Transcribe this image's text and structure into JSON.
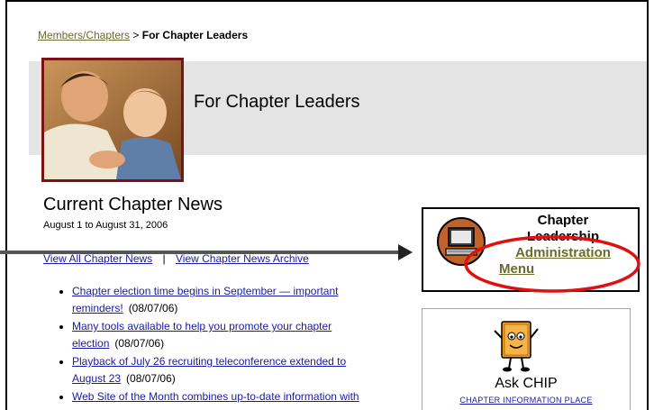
{
  "breadcrumb": {
    "parent": "Members/Chapters",
    "separator": ">",
    "current": "For Chapter Leaders"
  },
  "header": {
    "title": "For Chapter Leaders",
    "image": "father-and-son-photo"
  },
  "news": {
    "heading": "Current Chapter News",
    "date_range": "August 1 to August 31, 2006",
    "link_all": "View All Chapter News",
    "link_separator": "|",
    "link_archive": "View Chapter News Archive",
    "items": [
      {
        "lines": [
          "Chapter election time begins in September — important",
          "reminders!"
        ],
        "date": "(08/07/06)"
      },
      {
        "lines": [
          "Many tools available to help you promote your chapter",
          "election"
        ],
        "date": "(08/07/06)"
      },
      {
        "lines": [
          "Playback of July 26 recruiting teleconference extended to",
          "August 23"
        ],
        "date": "(08/07/06)"
      },
      {
        "lines": [
          "Web Site of the Month combines up-to-date information with"
        ],
        "date": ""
      }
    ]
  },
  "leadership_box": {
    "line1": "Chapter",
    "line2": "Leadership",
    "line3": "Administration",
    "line4": "Menu",
    "icon": "computer-icon"
  },
  "chip_box": {
    "title": "Ask CHIP",
    "subtitle": "CHAPTER INFORMATION PLACE",
    "icon": "chip-book-mascot-icon"
  },
  "colors": {
    "link": "#1a1aa6",
    "olive_link": "#6b6b2a",
    "photo_border": "#7a1414",
    "highlight_ellipse": "#e01010",
    "header_band": "#e4e4e4"
  }
}
